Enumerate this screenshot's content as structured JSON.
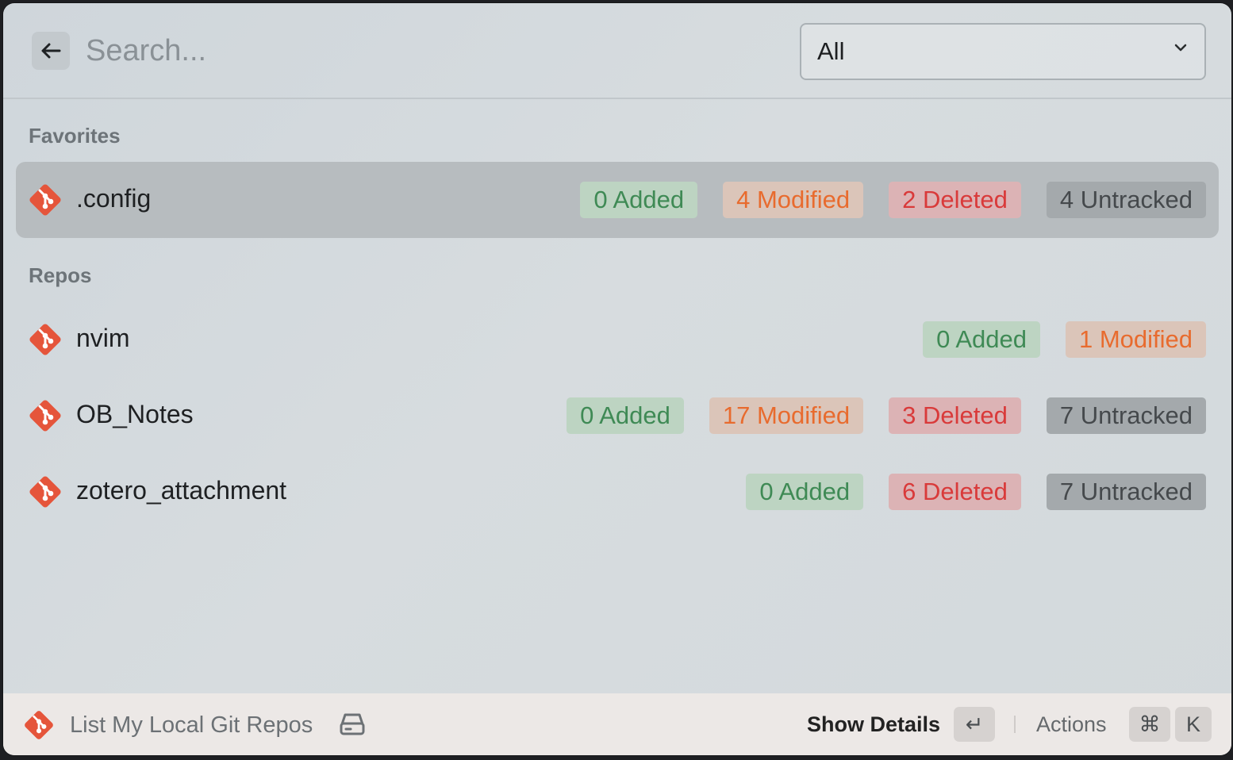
{
  "search": {
    "placeholder": "Search..."
  },
  "filter": {
    "selected": "All"
  },
  "sections": [
    {
      "title": "Favorites",
      "repos": [
        {
          "name": ".config",
          "badges": [
            {
              "text": "0 Added",
              "kind": "added"
            },
            {
              "text": "4 Modified",
              "kind": "modified"
            },
            {
              "text": "2 Deleted",
              "kind": "deleted"
            },
            {
              "text": "4 Untracked",
              "kind": "untracked"
            }
          ]
        }
      ]
    },
    {
      "title": "Repos",
      "repos": [
        {
          "name": "nvim",
          "badges": [
            {
              "text": "0 Added",
              "kind": "added"
            },
            {
              "text": "1 Modified",
              "kind": "modified"
            }
          ]
        },
        {
          "name": "OB_Notes",
          "badges": [
            {
              "text": "0 Added",
              "kind": "added"
            },
            {
              "text": "17 Modified",
              "kind": "modified"
            },
            {
              "text": "3 Deleted",
              "kind": "deleted"
            },
            {
              "text": "7 Untracked",
              "kind": "untracked"
            }
          ]
        },
        {
          "name": "zotero_attachment",
          "badges": [
            {
              "text": "0 Added",
              "kind": "added"
            },
            {
              "text": "6 Deleted",
              "kind": "deleted"
            },
            {
              "text": "7 Untracked",
              "kind": "untracked"
            }
          ]
        }
      ]
    }
  ],
  "footer": {
    "command_title": "List My Local Git Repos",
    "primary_action": "Show Details",
    "primary_key": "↵",
    "actions_label": "Actions",
    "actions_keys": [
      "⌘",
      "K"
    ]
  },
  "colors": {
    "git_orange": "#e5553b",
    "added_text": "#3f8a55",
    "modified_text": "#e86b2e",
    "deleted_text": "#d93a3a",
    "untracked_text": "#45494c"
  },
  "icons": {
    "back": "arrow-left-icon",
    "dropdown": "chevron-down-icon",
    "repo": "git-icon",
    "drive": "hard-drive-icon"
  }
}
